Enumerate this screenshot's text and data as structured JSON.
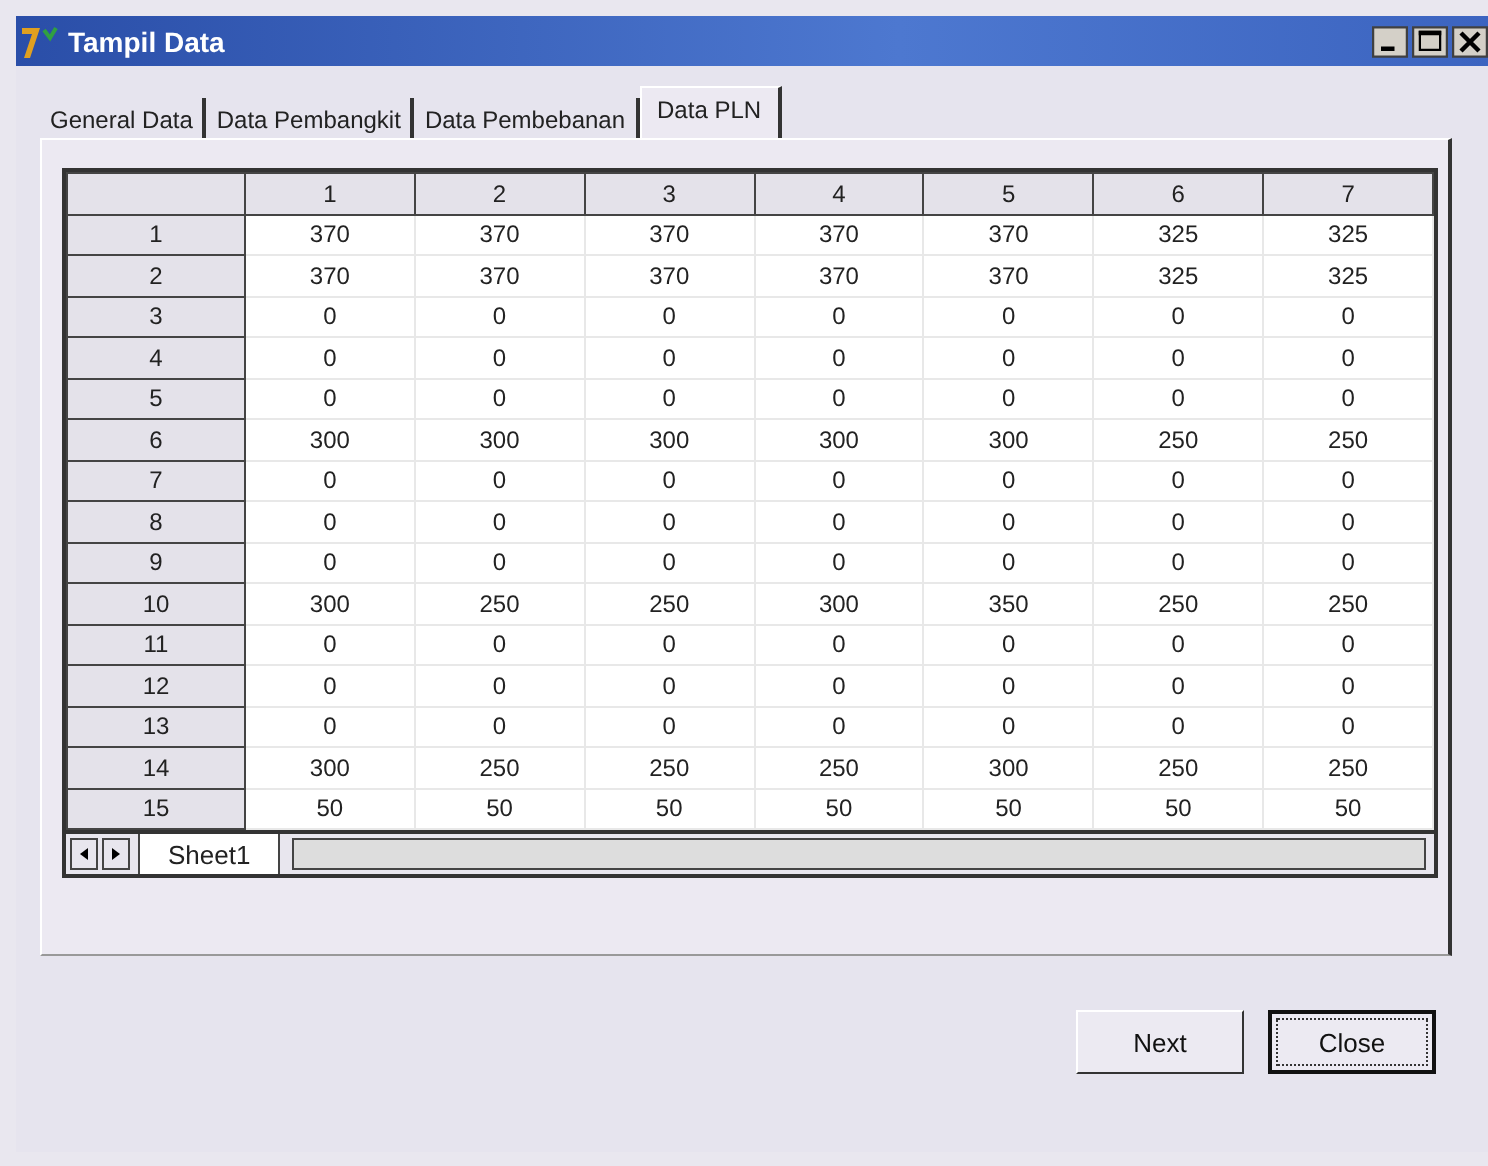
{
  "window": {
    "title": "Tampil Data"
  },
  "tabs": [
    {
      "label": "General Data",
      "selected": false
    },
    {
      "label": "Data Pembangkit",
      "selected": false
    },
    {
      "label": "Data Pembebanan",
      "selected": false
    },
    {
      "label": "Data PLN",
      "selected": true
    }
  ],
  "grid": {
    "columns": [
      "1",
      "2",
      "3",
      "4",
      "5",
      "6",
      "7"
    ],
    "rows": [
      {
        "header": "1",
        "cells": [
          "370",
          "370",
          "370",
          "370",
          "370",
          "325",
          "325"
        ]
      },
      {
        "header": "2",
        "cells": [
          "370",
          "370",
          "370",
          "370",
          "370",
          "325",
          "325"
        ]
      },
      {
        "header": "3",
        "cells": [
          "0",
          "0",
          "0",
          "0",
          "0",
          "0",
          "0"
        ]
      },
      {
        "header": "4",
        "cells": [
          "0",
          "0",
          "0",
          "0",
          "0",
          "0",
          "0"
        ]
      },
      {
        "header": "5",
        "cells": [
          "0",
          "0",
          "0",
          "0",
          "0",
          "0",
          "0"
        ]
      },
      {
        "header": "6",
        "cells": [
          "300",
          "300",
          "300",
          "300",
          "300",
          "250",
          "250"
        ]
      },
      {
        "header": "7",
        "cells": [
          "0",
          "0",
          "0",
          "0",
          "0",
          "0",
          "0"
        ]
      },
      {
        "header": "8",
        "cells": [
          "0",
          "0",
          "0",
          "0",
          "0",
          "0",
          "0"
        ]
      },
      {
        "header": "9",
        "cells": [
          "0",
          "0",
          "0",
          "0",
          "0",
          "0",
          "0"
        ]
      },
      {
        "header": "10",
        "cells": [
          "300",
          "250",
          "250",
          "300",
          "350",
          "250",
          "250"
        ]
      },
      {
        "header": "11",
        "cells": [
          "0",
          "0",
          "0",
          "0",
          "0",
          "0",
          "0"
        ]
      },
      {
        "header": "12",
        "cells": [
          "0",
          "0",
          "0",
          "0",
          "0",
          "0",
          "0"
        ]
      },
      {
        "header": "13",
        "cells": [
          "0",
          "0",
          "0",
          "0",
          "0",
          "0",
          "0"
        ]
      },
      {
        "header": "14",
        "cells": [
          "300",
          "250",
          "250",
          "250",
          "300",
          "250",
          "250"
        ]
      },
      {
        "header": "15",
        "cells": [
          "50",
          "50",
          "50",
          "50",
          "50",
          "50",
          "50"
        ]
      }
    ],
    "sheet_tabs": [
      {
        "label": "Sheet1",
        "selected": true
      }
    ]
  },
  "buttons": [
    {
      "label": "Next",
      "default": false
    },
    {
      "label": "Close",
      "default": true
    }
  ]
}
